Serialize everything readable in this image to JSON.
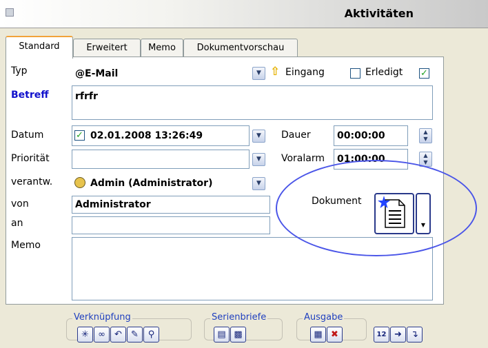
{
  "window": {
    "title": "Aktivitäten"
  },
  "tabs": [
    {
      "label": "Standard"
    },
    {
      "label": "Erweitert"
    },
    {
      "label": "Memo"
    },
    {
      "label": "Dokumentvorschau"
    }
  ],
  "form": {
    "typ": {
      "label": "Typ",
      "value": "@E-Mail"
    },
    "eingang": {
      "label": "Eingang",
      "checked": false
    },
    "erledigt": {
      "label": "Erledigt",
      "checked": true
    },
    "betreff": {
      "label": "Betreff",
      "value": "rfrfr"
    },
    "datum": {
      "label": "Datum",
      "value": "02.01.2008 13:26:49",
      "checked": true
    },
    "dauer": {
      "label": "Dauer",
      "value": "00:00:00"
    },
    "prioritaet": {
      "label": "Priorität",
      "value": ""
    },
    "voralarm": {
      "label": "Voralarm",
      "value": "01:00:00"
    },
    "verantw": {
      "label": "verantw.",
      "value": "Admin (Administrator)"
    },
    "von": {
      "label": "von",
      "value": "Administrator"
    },
    "an": {
      "label": "an",
      "value": ""
    },
    "memo": {
      "label": "Memo",
      "value": ""
    },
    "dokument": {
      "label": "Dokument"
    }
  },
  "toolbar": {
    "verknuepfung": {
      "label": "Verknüpfung"
    },
    "serienbriefe": {
      "label": "Serienbriefe"
    },
    "ausgabe": {
      "label": "Ausgabe"
    },
    "date_button_text": "12"
  },
  "colors": {
    "accent_tab": "#f1a23a",
    "label_blue": "#1111cc",
    "highlight_ellipse": "#4a55e8"
  }
}
